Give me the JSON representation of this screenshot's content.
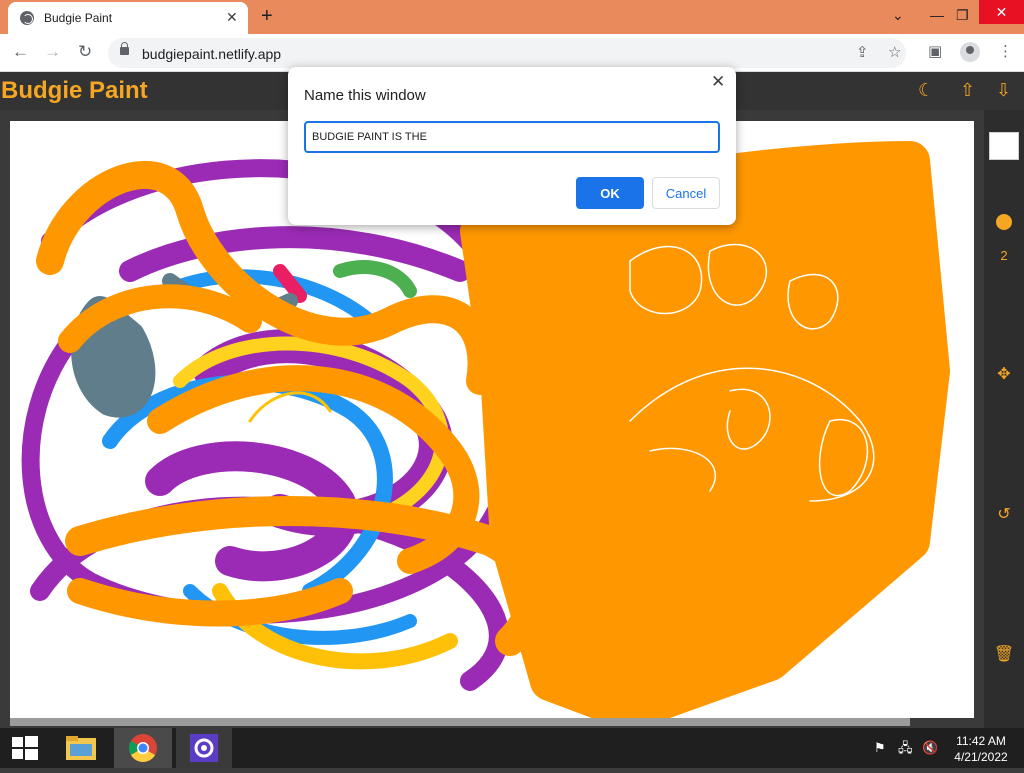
{
  "browser": {
    "tab_title": "Budgie Paint",
    "url": "budgiepaint.netlify.app"
  },
  "app": {
    "title": "Budgie Paint",
    "accent_color": "#f5a623",
    "brush_size": "2"
  },
  "dialog": {
    "title": "Name this window",
    "input_value": "BUDGIE PAINT IS THE",
    "ok_label": "OK",
    "cancel_label": "Cancel"
  },
  "taskbar": {
    "time": "11:42 AM",
    "date": "4/21/2022"
  },
  "icons": {
    "theme_toggle": "moon-icon",
    "upload": "upload-icon",
    "download": "download-icon",
    "move": "move-icon",
    "undo": "undo-icon",
    "trash": "trash-icon"
  }
}
